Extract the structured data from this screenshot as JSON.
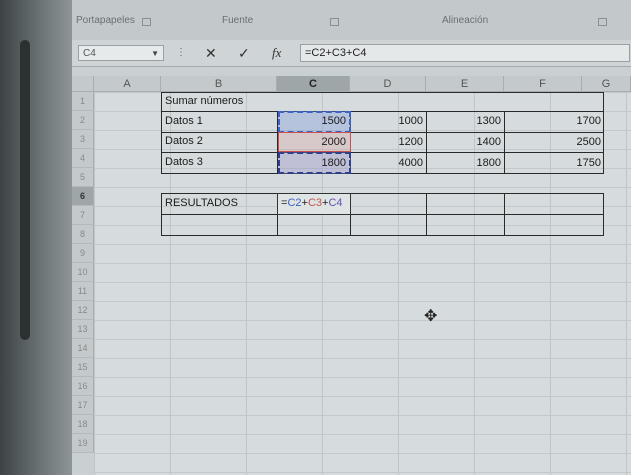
{
  "ribbon": {
    "groups": [
      "Portapapeles",
      "Fuente",
      "Alineación"
    ]
  },
  "formula_bar": {
    "name_box": "C4",
    "cancel_icon": "✕",
    "enter_icon": "✓",
    "fx_icon": "fx",
    "formula": "=C2+C3+C4"
  },
  "columns": [
    "A",
    "B",
    "C",
    "D",
    "E",
    "F",
    "G"
  ],
  "active_column": "C",
  "rows": [
    "1",
    "2",
    "3",
    "4",
    "5",
    "6",
    "7",
    "8",
    "9",
    "10",
    "11",
    "12",
    "13",
    "14",
    "15",
    "16",
    "17",
    "18",
    "19"
  ],
  "active_row": "6",
  "sheet": {
    "title": "Sumar números",
    "data_rows": [
      {
        "label": "Datos 1",
        "values": [
          "1500",
          "1000",
          "1300",
          "1700"
        ]
      },
      {
        "label": "Datos 2",
        "values": [
          "2000",
          "1200",
          "1400",
          "2500"
        ]
      },
      {
        "label": "Datos 3",
        "values": [
          "1800",
          "4000",
          "1800",
          "1750"
        ]
      }
    ],
    "results_label": "RESULTADOS",
    "editing_formula": {
      "c2": "C2",
      "c3": "C3",
      "c4": "C4",
      "eq": "=",
      "plus": "+"
    }
  },
  "colors": {
    "ref_c2": "#3b63c9",
    "ref_c3": "#c8514d",
    "ref_c4": "#2d3f8e"
  }
}
